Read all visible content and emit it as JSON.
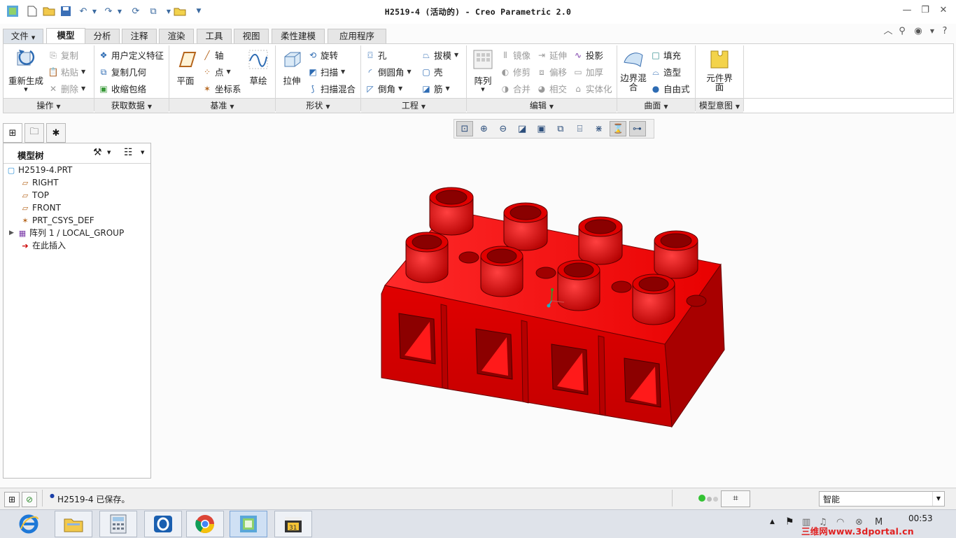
{
  "window": {
    "title": "H2519-4 (活动的) - Creo Parametric 2.0"
  },
  "ribbon_tabs": [
    "文件",
    "模型",
    "分析",
    "注释",
    "渲染",
    "工具",
    "视图",
    "柔性建模",
    "应用程序"
  ],
  "active_tab": "模型",
  "groups": {
    "operations": {
      "label": "操作",
      "regenerate": "重新生成",
      "copy": "复制",
      "paste": "粘贴",
      "delete": "删除"
    },
    "get_data": {
      "label": "获取数据",
      "udf": "用户定义特征",
      "copy_geom": "复制几何",
      "shrinkwrap": "收缩包络"
    },
    "datum": {
      "label": "基准",
      "plane": "平面",
      "axis": "轴",
      "point": "点",
      "csys": "坐标系",
      "sketch": "草绘"
    },
    "shapes": {
      "label": "形状",
      "extrude": "拉伸",
      "revolve": "旋转",
      "sweep": "扫描",
      "swept_blend": "扫描混合"
    },
    "engineering": {
      "label": "工程",
      "hole": "孔",
      "round": "倒圆角",
      "chamfer": "倒角",
      "draft": "拔模",
      "shell": "壳",
      "rib": "筋"
    },
    "editing": {
      "label": "编辑",
      "pattern": "阵列",
      "mirror": "镜像",
      "trim": "修剪",
      "merge": "合并",
      "extend": "延伸",
      "offset": "偏移",
      "intersect": "相交",
      "project": "投影",
      "thicken": "加厚",
      "solidify": "实体化"
    },
    "surfaces": {
      "label": "曲面",
      "boundary_blend": "边界混合",
      "fill": "填充",
      "style": "造型",
      "freestyle": "自由式"
    },
    "model_intent": {
      "label": "模型意图",
      "component_interface": "元件界面"
    }
  },
  "model_tree": {
    "header": "模型树",
    "items": [
      {
        "label": "H2519-4.PRT",
        "icon": "part-icon"
      },
      {
        "label": "RIGHT",
        "icon": "datum-plane-icon"
      },
      {
        "label": "TOP",
        "icon": "datum-plane-icon"
      },
      {
        "label": "FRONT",
        "icon": "datum-plane-icon"
      },
      {
        "label": "PRT_CSYS_DEF",
        "icon": "csys-icon"
      },
      {
        "label": "阵列 1 / LOCAL_GROUP",
        "icon": "pattern-icon"
      },
      {
        "label": "在此插入",
        "icon": "insert-arrow-icon"
      }
    ]
  },
  "status_bar": {
    "message": "H2519-4 已保存。",
    "filter": "智能"
  },
  "taskbar": {
    "clock": "00:53",
    "watermark": "三维网www.3dportal.cn"
  },
  "colors": {
    "model_red": "#e60000",
    "accent_blue": "#2d6bb3"
  }
}
